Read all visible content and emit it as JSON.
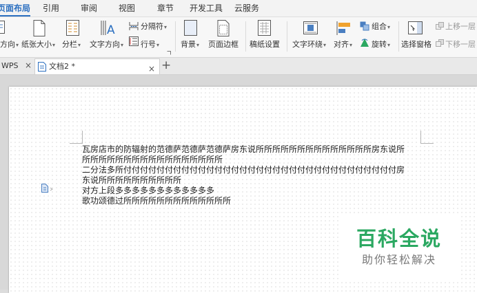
{
  "menu": {
    "tabs": [
      {
        "label": "页面布局",
        "active": true
      },
      {
        "label": "引用"
      },
      {
        "label": "审阅"
      },
      {
        "label": "视图"
      },
      {
        "label": "章节"
      },
      {
        "label": "开发工具"
      },
      {
        "label": "云服务"
      }
    ]
  },
  "ribbon": {
    "orientation": "方向",
    "paper_size": "纸张大小",
    "columns": "分栏",
    "text_direction": "文字方向",
    "separator": "分隔符",
    "line_number": "行号",
    "background": "背景",
    "page_border": "页面边框",
    "paper_setup": "稿纸设置",
    "text_wrap": "文字环绕",
    "align": "对齐",
    "group": "组合",
    "rotate": "旋转",
    "selection_pane": "选择窗格",
    "move_up": "上移一层",
    "move_down": "下移一层"
  },
  "doc_tabs": {
    "wps_tab": "WPS",
    "doc_tab": "文档2 *",
    "new_tab": "+",
    "close_icon": "×"
  },
  "document": {
    "lines": [
      "瓦房店市的防辐射的范德萨范德萨范德萨房东说所所所所所所所所所所所所所所房东说所",
      "所所所所所所所所所所所所所所所所所",
      "二分法多所付付付付付付付付付付付付付付付付付付付付付付付付付付付付付付付付付房",
      "东说所所所所所所所所所所",
      "对方上段多多多多多多多多多多多多",
      "歌功颂德过所所所所所所所所所所所所所"
    ]
  },
  "watermark": {
    "title": "百科全说",
    "subtitle": "助你轻松解决",
    "color": "#2ba861"
  },
  "colors": {
    "accent": "#2b6fc0",
    "text_wrap_icon": "#4a7fc1",
    "align_icon": "#f0a22e"
  }
}
